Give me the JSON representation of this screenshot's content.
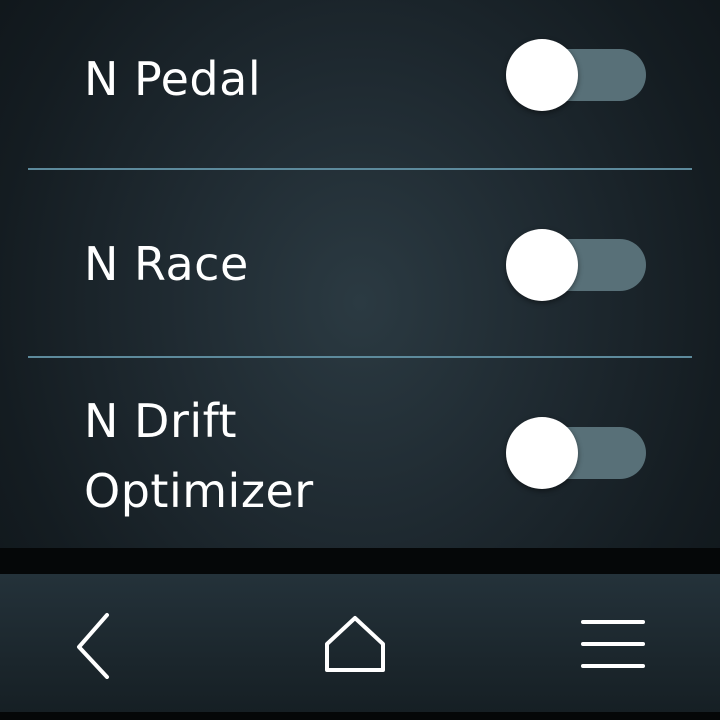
{
  "settings": {
    "items": [
      {
        "label": "N Pedal",
        "enabled": false
      },
      {
        "label": "N Race",
        "enabled": false
      },
      {
        "label": "N Drift\nOptimizer",
        "enabled": false
      }
    ]
  },
  "navigation": {
    "buttons": [
      {
        "icon": "back-chevron-icon"
      },
      {
        "icon": "home-icon"
      },
      {
        "icon": "menu-icon"
      }
    ]
  },
  "colors": {
    "background": "#1f2a31",
    "toggle_track_off": "#587078",
    "toggle_knob": "#ffffff",
    "divider": "#5d8a9c",
    "text": "#ffffff"
  }
}
